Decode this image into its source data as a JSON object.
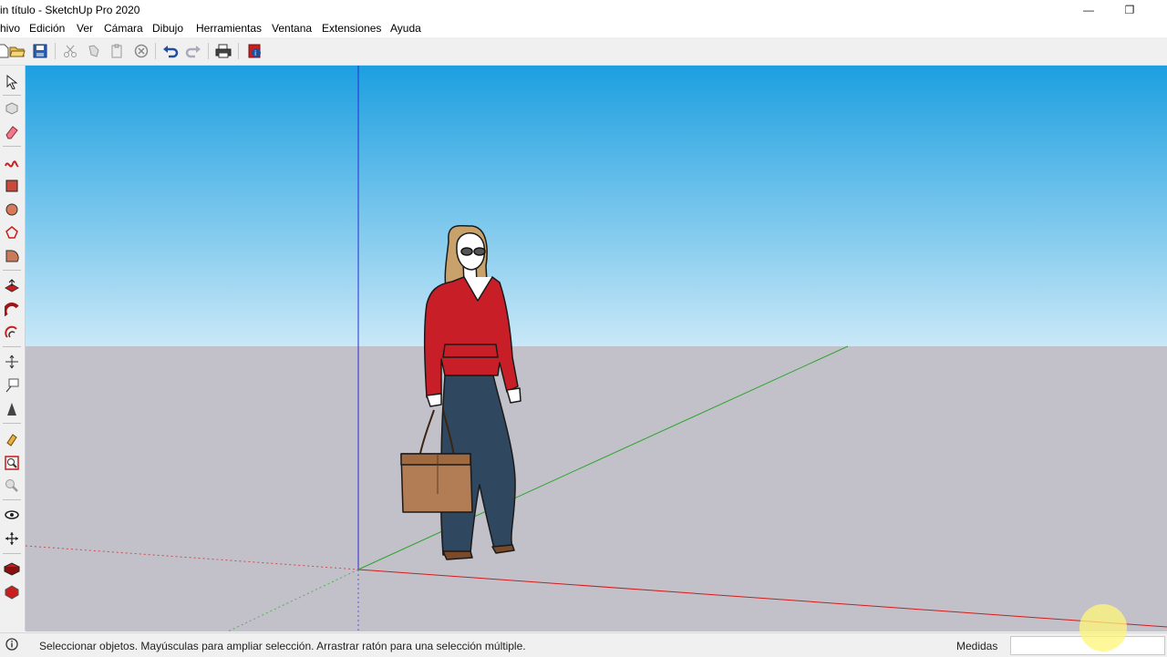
{
  "window": {
    "title": "in título - SketchUp Pro 2020",
    "minimize_glyph": "—",
    "restore_glyph": "❐"
  },
  "menu": {
    "items": [
      "hivo",
      "Edición",
      "Ver",
      "Cámara",
      "Dibujo",
      "Herramientas",
      "Ventana",
      "Extensiones",
      "Ayuda"
    ]
  },
  "toolbar": {
    "buttons": [
      "new-icon",
      "open-icon",
      "save-icon",
      "cut-icon",
      "copy-icon",
      "paste-icon",
      "erase-icon",
      "undo-icon",
      "redo-icon",
      "print-icon",
      "model-info-icon"
    ]
  },
  "tools": [
    "select-icon",
    "make-component-icon",
    "eraser-icon",
    "freehand-icon",
    "rectangle-icon",
    "circle-icon",
    "polygon-icon",
    "arc-icon",
    "push-pull-icon",
    "follow-me-icon",
    "offset-icon",
    "move-icon",
    "text-icon",
    "dimension-icon",
    "paint-bucket-icon",
    "zoom-extents-icon",
    "zoom-icon",
    "orbit-icon",
    "walk-icon",
    "warehouse-icon",
    "extension-warehouse-icon"
  ],
  "viewport": {
    "sky_top": "#1c9fe0",
    "sky_bottom": "#c9e8f7",
    "ground": "#c2c1c9"
  },
  "axes": {
    "red": "#d11c1c",
    "green": "#2aa52a",
    "blue": "#2a2ad8"
  },
  "status": {
    "text": "Seleccionar objetos. Mayúsculas para ampliar selección. Arrastrar ratón para una selección múltiple.",
    "measurements_label": "Medidas",
    "measurements_value": ""
  }
}
